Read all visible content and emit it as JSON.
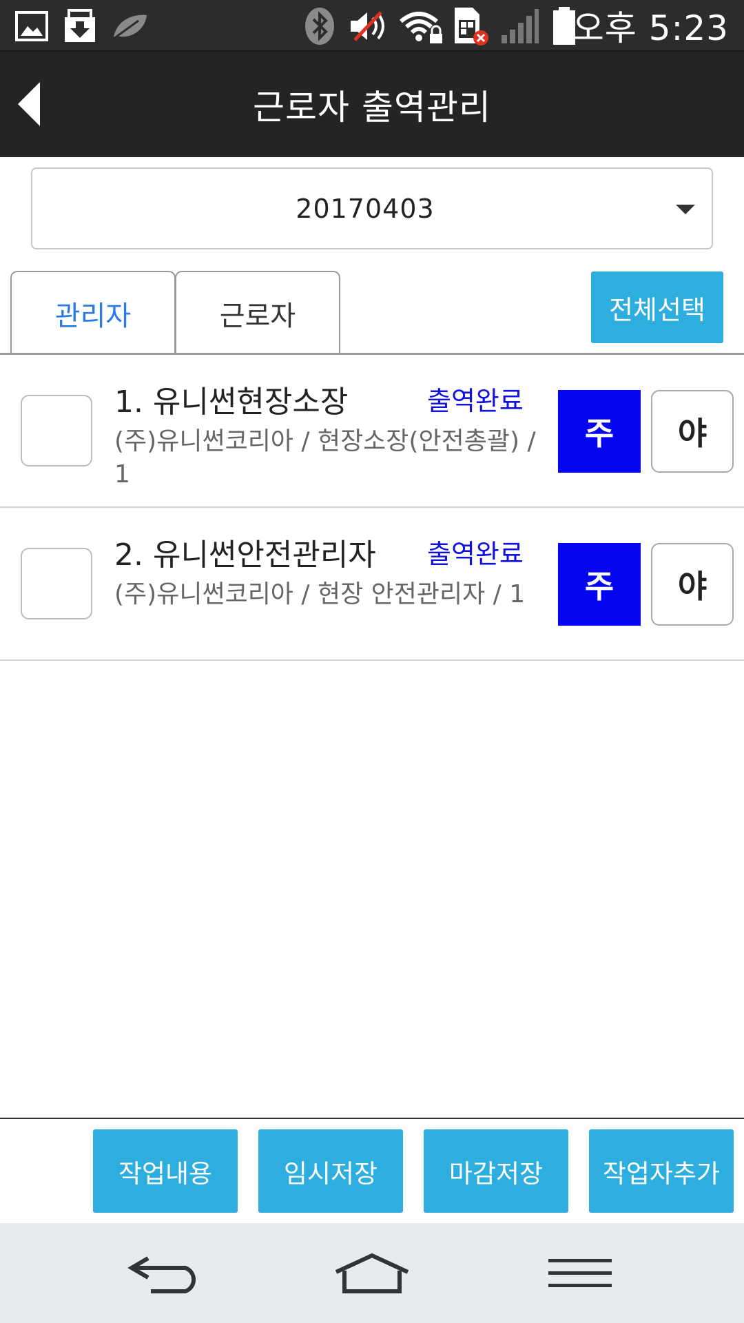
{
  "status_bar": {
    "time": "오후 5:23",
    "icons": [
      "image-icon",
      "download-icon",
      "leaf-icon",
      "bluetooth-icon",
      "mute-icon",
      "wifi-lock-icon",
      "sim-error-icon",
      "signal-icon",
      "battery-icon"
    ]
  },
  "header": {
    "title": "근로자 출역관리",
    "back_icon": "back-arrow-icon"
  },
  "date_select": {
    "value": "20170403"
  },
  "tabs": [
    {
      "label": "관리자",
      "active": true
    },
    {
      "label": "근로자",
      "active": false
    }
  ],
  "select_all_label": "전체선택",
  "rows": [
    {
      "name": "1. 유니썬현장소장",
      "status": "출역완료",
      "detail": "(주)유니썬코리아 / 현장소장(안전총괄) / 1",
      "day_label": "주",
      "night_label": "야"
    },
    {
      "name": "2. 유니썬안전관리자",
      "status": "출역완료",
      "detail": "(주)유니썬코리아 / 현장 안전관리자 / 1",
      "day_label": "주",
      "night_label": "야"
    }
  ],
  "actions": {
    "work_content": "작업내용",
    "temp_save": "임시저장",
    "final_save": "마감저장",
    "add_worker": "작업자추가"
  },
  "colors": {
    "accent": "#2eaedf",
    "day_button": "#0505f0",
    "status_text": "#1010e0",
    "active_tab": "#2a7be4",
    "header_bg": "#232425"
  },
  "nav_icons": [
    "back-icon",
    "home-icon",
    "menu-icon"
  ]
}
